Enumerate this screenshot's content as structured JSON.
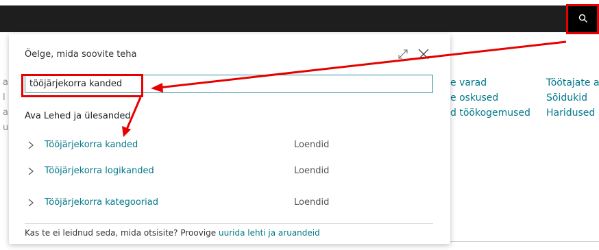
{
  "background": {
    "columns": [
      {
        "items": [
          "e varad",
          "e oskused",
          "d töökogemused"
        ]
      },
      {
        "items": [
          "Töötajate a",
          "Sõidukid",
          "Haridused"
        ]
      }
    ]
  },
  "dialog": {
    "title": "Öelge, mida soovite teha",
    "search_value": "tööjärjekorra kanded",
    "section_heading": "Ava Lehed ja ülesanded",
    "results": [
      {
        "label": "Tööjärjekorra kanded",
        "category": "Loendid"
      },
      {
        "label": "Tööjärjekorra logikanded",
        "category": "Loendid"
      },
      {
        "label": "Tööjärjekorra kategooriad",
        "category": "Loendid"
      }
    ],
    "footer_text": "Kas te ei leidnud seda, mida otsisite? Proovige ",
    "footer_link": "uurida lehti ja aruandeid"
  },
  "icons": {
    "search": "search-icon",
    "expand": "expand-icon",
    "close": "close-icon",
    "chevron": "chevron-right-icon"
  },
  "colors": {
    "accent": "#00788a",
    "topbar": "#1e1e1e",
    "annotation": "#e60000"
  }
}
